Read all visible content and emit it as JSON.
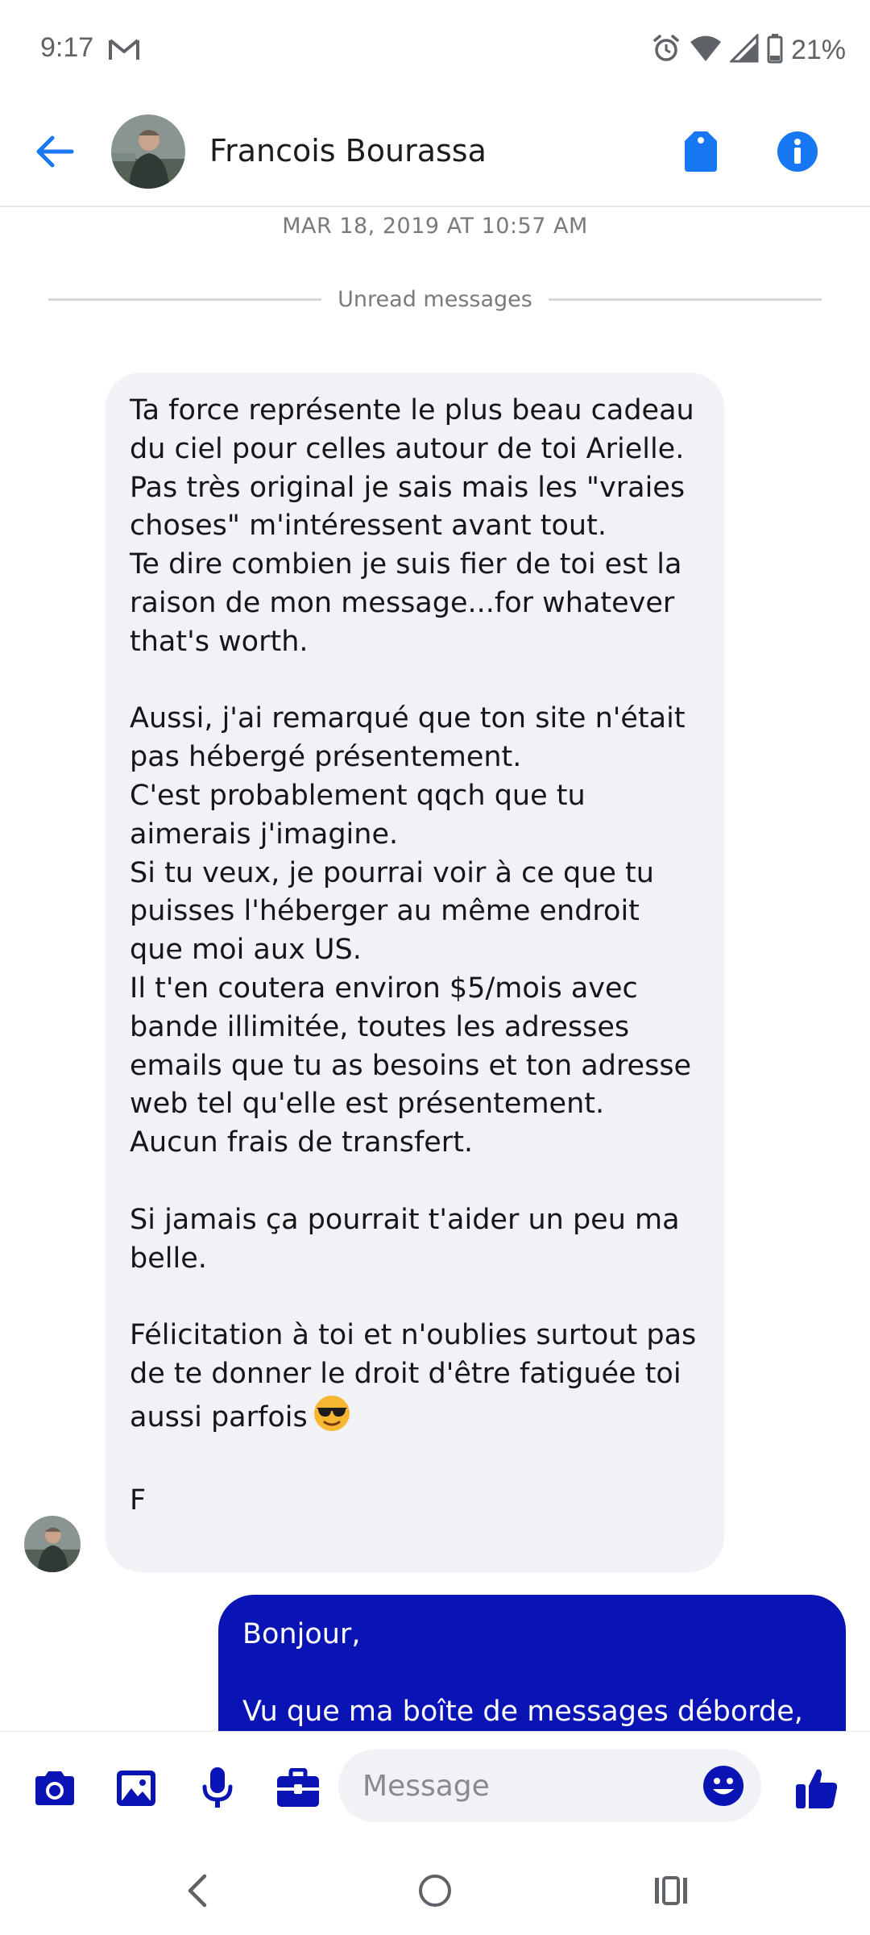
{
  "status_bar": {
    "time": "9:17",
    "battery": "21%",
    "icons": [
      "gmail-icon",
      "alarm-icon",
      "wifi-icon",
      "signal-icon",
      "battery-icon"
    ]
  },
  "header": {
    "contact_name": "Francois Bourassa",
    "icons": [
      "back-arrow-icon",
      "tag-icon",
      "info-icon"
    ]
  },
  "conversation": {
    "timestamp": "MAR 18, 2019 AT 10:57 AM",
    "unread_label": "Unread messages",
    "incoming": {
      "text": "Ta force représente le plus beau cadeau du ciel pour celles autour de toi Arielle.\nPas très original je sais mais les \"vraies choses\" m'intéressent avant tout.\nTe dire combien je suis fier de toi est la raison de mon message...for whatever that's worth.\n\nAussi, j'ai remarqué que ton site n'était pas hébergé présentement.\nC'est probablement qqch que tu aimerais j'imagine.\nSi tu veux, je pourrai voir à ce que tu puisses l'héberger au même endroit que moi aux US.\nIl t'en coutera environ $5/mois avec bande illimitée, toutes les adresses emails que tu as besoins et ton adresse web tel qu'elle est présentement.\nAucun frais de transfert.\n\nSi jamais ça pourrait t'aider un peu ma belle.\n\nFélicitation à toi et n'oublies surtout pas de te donner le droit d'être fatiguée toi aussi parfois",
      "emoji": "smiling-face-with-sunglasses",
      "signature": "F"
    },
    "outgoing": {
      "text": "Bonjour,\n\nVu que ma boîte de messages déborde,"
    }
  },
  "composer": {
    "placeholder": "Message",
    "icons": [
      "camera-icon",
      "gallery-icon",
      "microphone-icon",
      "briefcase-icon",
      "emoji-icon",
      "thumbs-up-icon"
    ]
  },
  "nav_bar": {
    "icons": [
      "back-icon",
      "home-icon",
      "recents-icon"
    ]
  },
  "colors": {
    "accent": "#0a14b4",
    "icon_blue": "#1877f2",
    "incoming_bubble": "#f1f2f6",
    "outgoing_bubble": "#0a14b4"
  }
}
